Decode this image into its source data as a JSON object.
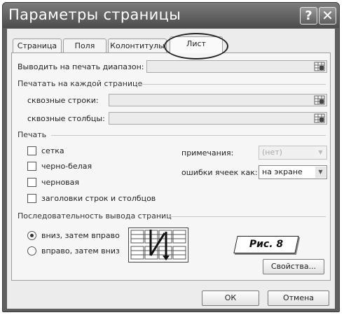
{
  "window": {
    "title": "Параметры страницы",
    "help_glyph": "?",
    "close_glyph": "✕"
  },
  "tabs": [
    {
      "label": "Страница"
    },
    {
      "label": "Поля"
    },
    {
      "label": "Колонтитулы"
    },
    {
      "label": "Лист",
      "active": true
    }
  ],
  "print_area": {
    "label": "Выводить на печать диапазон:",
    "value": ""
  },
  "print_titles": {
    "group_title": "Печатать на каждой странице",
    "rows_label": "сквозные строки:",
    "rows_value": "",
    "cols_label": "сквозные столбцы:",
    "cols_value": ""
  },
  "print": {
    "group_title": "Печать",
    "gridlines": {
      "label": "сетка",
      "checked": false
    },
    "black_white": {
      "label": "черно-белая",
      "checked": false
    },
    "draft": {
      "label": "черновая",
      "checked": false
    },
    "headings": {
      "label": "заголовки строк и столбцов",
      "checked": false
    },
    "comments_label": "примечания:",
    "comments_value": "(нет)",
    "errors_label": "ошибки ячеек как:",
    "errors_value": "на экране"
  },
  "page_order": {
    "group_title": "Последовательность вывода страниц",
    "down_then_over": {
      "label": "вниз, затем вправо",
      "selected": true
    },
    "over_then_down": {
      "label": "вправо, затем вниз",
      "selected": false
    }
  },
  "figure_caption": "Рис. 8",
  "buttons": {
    "options": "Свойства...",
    "ok": "ОК",
    "cancel": "Отмена"
  },
  "icons": {
    "range_collapse": "range-collapse-icon",
    "page_order_preview": "page-order-preview-icon"
  }
}
